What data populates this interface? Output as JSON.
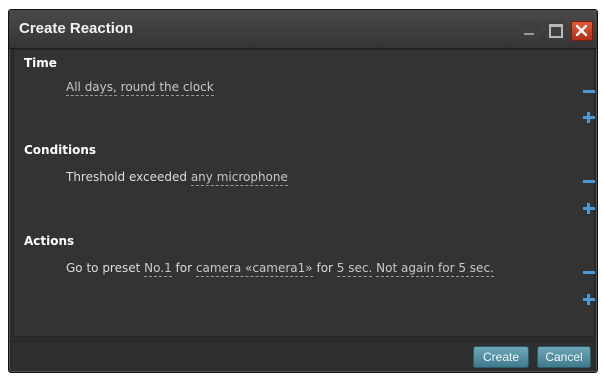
{
  "window": {
    "title": "Create Reaction"
  },
  "sections": {
    "time": {
      "heading": "Time",
      "link1": "All days,",
      "link2": "round the clock"
    },
    "conditions": {
      "heading": "Conditions",
      "prefix": "Threshold exceeded",
      "link1": "any microphone"
    },
    "actions": {
      "heading": "Actions",
      "t1": "Go to preset",
      "link1": "No.1",
      "t2": "for",
      "link2": "camera «camera1»",
      "t3": "for",
      "link3": "5 sec.",
      "link4": "Not again for 5 sec."
    }
  },
  "footer": {
    "create_label": "Create",
    "cancel_label": "Cancel"
  },
  "colors": {
    "accent": "#4a9ad8",
    "button": "#5a96a8",
    "close": "#c9401f",
    "background": "#333333"
  }
}
